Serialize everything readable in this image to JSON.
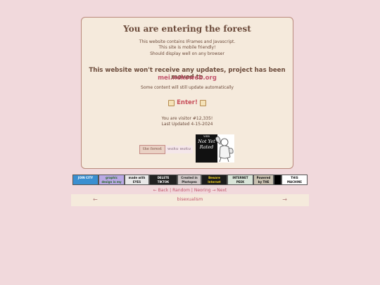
{
  "main": {
    "title": "You are entering the forest",
    "info_line1": "This website contains IFrames and Javascript.",
    "info_line2": "This site is mobile friendly!",
    "info_line3": "Should display well on any browser",
    "moved_text": "This website won't receive any updates, project has been moved to",
    "new_site": "mei.nekoweb.org",
    "some_content": "Some content will still update automatically",
    "enter_label": "Enter!",
    "visitor_text": "You are visitor #12,335!",
    "updated_text": "Last Updated 4-15-2024"
  },
  "badges": {
    "forest": "the forest",
    "waku": "waku waku",
    "notyet_web": "WEB",
    "notyet_line1": "Not Yet",
    "notyet_line2": "Rated"
  },
  "buttons88": [
    {
      "label": "JOIN CITY",
      "bg": "#3a8fd0",
      "fg": "#ffffff"
    },
    {
      "label": "graphic design is my passion",
      "bg": "#b9a8e4",
      "fg": "#2a6a2a"
    },
    {
      "label": "made with EYES",
      "bg": "#e8e8e8",
      "fg": "#111111"
    },
    {
      "label": "DELETE TIKTOK",
      "bg": "#222222",
      "fg": "#ffffff"
    },
    {
      "label": "Created in Photopea",
      "bg": "#d0c8c8",
      "fg": "#222222"
    },
    {
      "label": "Beware Internet Virus",
      "bg": "#1b1b1b",
      "fg": "#f0d020"
    },
    {
      "label": "INTERNET PEEK",
      "bg": "#d8e4d8",
      "fg": "#111111"
    },
    {
      "label": "Powered by THE VOID",
      "bg": "#c8c0b0",
      "fg": "#111111"
    },
    {
      "label": "",
      "bg": "#000000",
      "fg": "#ffffff"
    },
    {
      "label": "THIS MACHINE KILLS FASCISTS",
      "bg": "#ffffff",
      "fg": "#111111"
    }
  ],
  "nav": {
    "back": "← Back",
    "sep1": "|",
    "random": "Random",
    "sep2": "|",
    "neoring": "Neoring",
    "next": "→ Next"
  },
  "ring": {
    "prev": "←",
    "name": "bisexualism",
    "next": "→"
  },
  "colors": {
    "background": "#f1d9dc",
    "card": "#f5eadc",
    "link": "#c2556c",
    "text": "#6b4a3a"
  }
}
